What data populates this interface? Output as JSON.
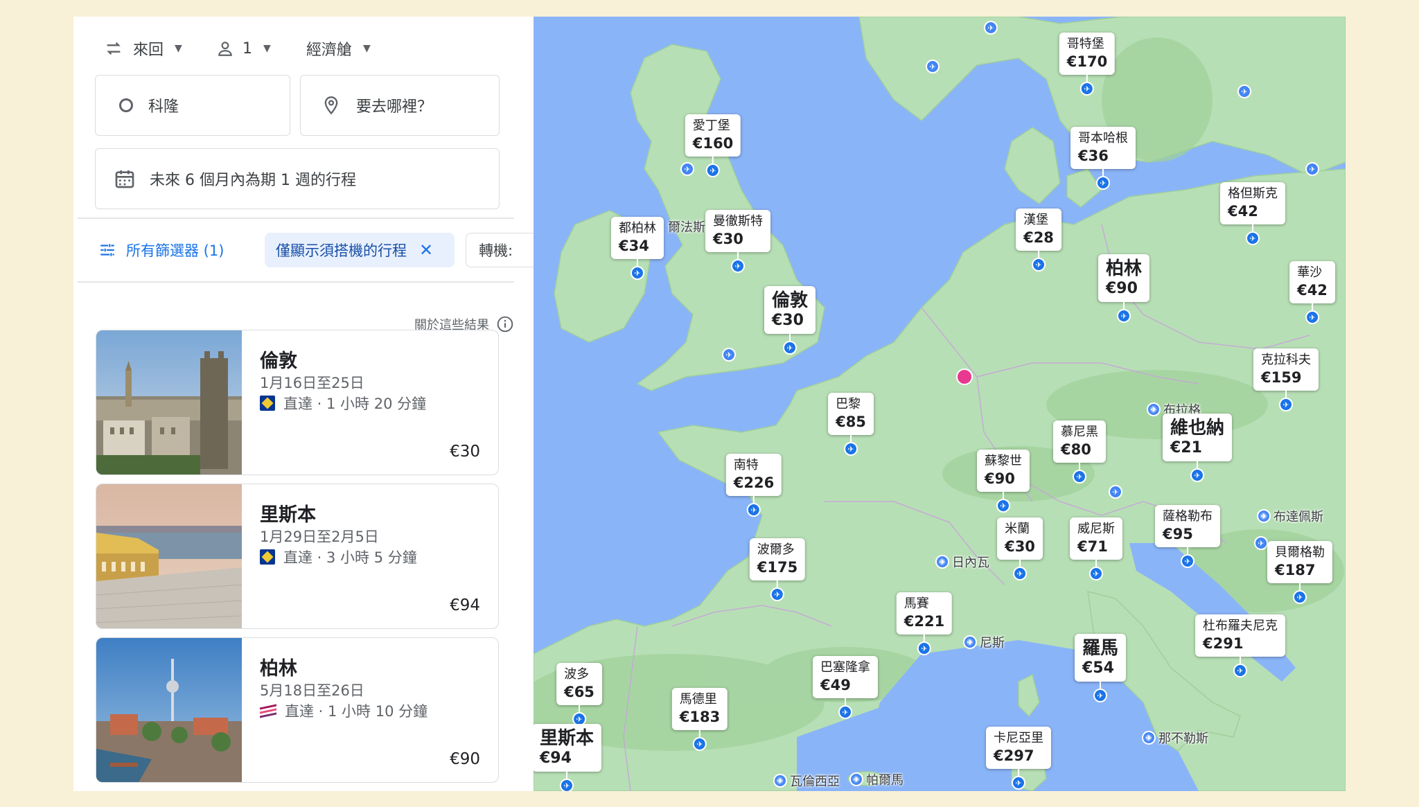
{
  "toolbar": {
    "trip_type": "來回",
    "passengers": "1",
    "cabin_class": "經濟艙"
  },
  "search": {
    "origin": "科隆",
    "destination_placeholder": "要去哪裡？",
    "dates": "未來 6 個月內為期 1 週的行程"
  },
  "filters": {
    "all_filters": "所有篩選器 (1)",
    "active_chip": "僅顯示須搭機的行程",
    "stops_chip": "轉機:"
  },
  "about_results": "關於這些結果",
  "results": [
    {
      "city": "倫敦",
      "dates": "1月16日至25日",
      "flight": "直達 · 1 小時 20 分鐘",
      "price": "€30",
      "airline_icon": "ryanair-logo-icon"
    },
    {
      "city": "里斯本",
      "dates": "1月29日至2月5日",
      "flight": "直達 · 3 小時 5 分鐘",
      "price": "€94",
      "airline_icon": "ryanair-logo-icon"
    },
    {
      "city": "柏林",
      "dates": "5月18日至26日",
      "flight": "直達 · 1 小時 10 分鐘",
      "price": "€90",
      "airline_icon": "eurowings-logo-icon"
    }
  ],
  "map": {
    "colors": {
      "water": "#8ab4f8",
      "land": "#b7dfb5",
      "land_dark": "#9fd09a",
      "origin": "#e8388f",
      "pin": "#1a73e8"
    },
    "destinations": [
      {
        "name": "哥特堡",
        "price": "€170",
        "big": false
      },
      {
        "name": "愛丁堡",
        "price": "€160",
        "big": false
      },
      {
        "name": "哥本哈根",
        "price": "€36",
        "big": false
      },
      {
        "name": "格但斯克",
        "price": "€42",
        "big": false
      },
      {
        "name": "都柏林",
        "price": "€34",
        "big": false
      },
      {
        "name": "曼徹斯特",
        "price": "€30",
        "big": false
      },
      {
        "name": "漢堡",
        "price": "€28",
        "big": false
      },
      {
        "name": "柏林",
        "price": "€90",
        "big": true
      },
      {
        "name": "華沙",
        "price": "€42",
        "big": false
      },
      {
        "name": "倫敦",
        "price": "€30",
        "big": true
      },
      {
        "name": "克拉科夫",
        "price": "€159",
        "big": false
      },
      {
        "name": "巴黎",
        "price": "€85",
        "big": false
      },
      {
        "name": "慕尼黑",
        "price": "€80",
        "big": false
      },
      {
        "name": "維也納",
        "price": "€21",
        "big": true
      },
      {
        "name": "蘇黎世",
        "price": "€90",
        "big": false
      },
      {
        "name": "南特",
        "price": "€226",
        "big": false
      },
      {
        "name": "米蘭",
        "price": "€30",
        "big": false
      },
      {
        "name": "威尼斯",
        "price": "€71",
        "big": false
      },
      {
        "name": "薩格勒布",
        "price": "€95",
        "big": false
      },
      {
        "name": "貝爾格勒",
        "price": "€187",
        "big": false
      },
      {
        "name": "波爾多",
        "price": "€175",
        "big": false
      },
      {
        "name": "馬賽",
        "price": "€221",
        "big": false
      },
      {
        "name": "杜布羅夫尼克",
        "price": "€291",
        "big": false
      },
      {
        "name": "羅馬",
        "price": "€54",
        "big": true
      },
      {
        "name": "巴塞隆拿",
        "price": "€49",
        "big": false
      },
      {
        "name": "波多",
        "price": "€65",
        "big": false
      },
      {
        "name": "馬德里",
        "price": "€183",
        "big": false
      },
      {
        "name": "卡尼亞里",
        "price": "€297",
        "big": false
      },
      {
        "name": "里斯本",
        "price": "€94",
        "big": true
      }
    ],
    "labels": [
      "布拉格",
      "布達佩斯",
      "日內瓦",
      "尼斯",
      "那不勒斯",
      "瓦倫西亞",
      "帕爾馬",
      "爾法斯"
    ]
  }
}
